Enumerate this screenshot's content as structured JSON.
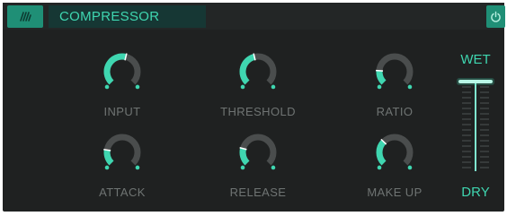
{
  "header": {
    "icon": "waveform-icon",
    "title": "COMPRESSOR",
    "power_icon": "power-icon"
  },
  "colors": {
    "accent": "#3fd6b0",
    "background": "#1f2121",
    "knob_track": "#4a4d4d",
    "label": "#6f7473"
  },
  "knobs": [
    {
      "label": "INPUT",
      "value": 0.55
    },
    {
      "label": "THRESHOLD",
      "value": 0.45
    },
    {
      "label": "RATIO",
      "value": 0.18
    },
    {
      "label": "ATTACK",
      "value": 0.2
    },
    {
      "label": "RELEASE",
      "value": 0.22
    },
    {
      "label": "MAKE UP",
      "value": 0.33
    }
  ],
  "mix": {
    "top_label": "WET",
    "bottom_label": "DRY",
    "value": 1.0
  }
}
